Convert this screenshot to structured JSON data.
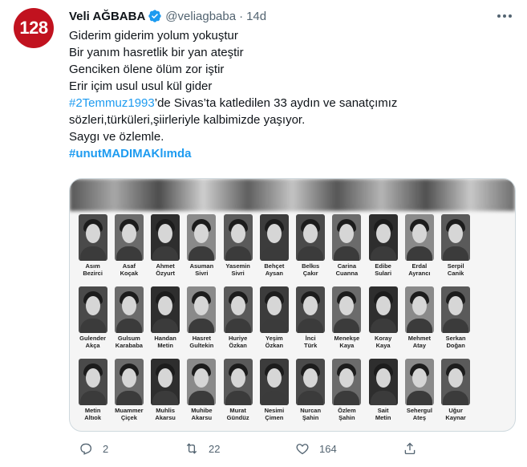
{
  "tweet": {
    "avatar_text": "128",
    "display_name": "Veli AĞBABA",
    "handle": "@veliagbaba",
    "separator": "·",
    "time": "14d",
    "body": {
      "l1": "Giderim giderim yolum yokuştur",
      "l2": "Bir yanım hasretlik bir yan ateştir",
      "l3": "Genciken ölene ölüm zor iştir",
      "l4": "Erir içim usul usul kül gider",
      "l5_hashtag": "#2Temmuz1993",
      "l5_rest": "’de Sivas’ta katledilen 33 aydın ve sanatçımız",
      "l6": "sözleri,türküleri,şiirleriyle kalbimizde yaşıyor.",
      "l7": "Saygı ve özlemle.",
      "l8_hashtag": "#unutMADIMAKlımda"
    }
  },
  "media": {
    "people": [
      {
        "n1": "Asım",
        "n2": "Bezirci"
      },
      {
        "n1": "Asaf",
        "n2": "Koçak"
      },
      {
        "n1": "Ahmet",
        "n2": "Özyurt"
      },
      {
        "n1": "Asuman",
        "n2": "Sivri"
      },
      {
        "n1": "Yasemin",
        "n2": "Sivri"
      },
      {
        "n1": "Behçet",
        "n2": "Aysan"
      },
      {
        "n1": "Belkıs",
        "n2": "Çakır"
      },
      {
        "n1": "Carina",
        "n2": "Cuanna"
      },
      {
        "n1": "Edibe",
        "n2": "Sulari"
      },
      {
        "n1": "Erdal",
        "n2": "Ayrancı"
      },
      {
        "n1": "Serpil",
        "n2": "Canik"
      },
      {
        "n1": "",
        "n2": ""
      },
      {
        "n1": "Gulender",
        "n2": "Akça"
      },
      {
        "n1": "Gulsum",
        "n2": "Karababa"
      },
      {
        "n1": "Handan",
        "n2": "Metin"
      },
      {
        "n1": "Hasret",
        "n2": "Gultekin"
      },
      {
        "n1": "Huriye",
        "n2": "Özkan"
      },
      {
        "n1": "Yeşim",
        "n2": "Özkan"
      },
      {
        "n1": "İnci",
        "n2": "Türk"
      },
      {
        "n1": "Menekşe",
        "n2": "Kaya"
      },
      {
        "n1": "Koray",
        "n2": "Kaya"
      },
      {
        "n1": "Mehmet",
        "n2": "Atay"
      },
      {
        "n1": "Serkan",
        "n2": "Doğan"
      },
      {
        "n1": "",
        "n2": ""
      },
      {
        "n1": "Metin",
        "n2": "Altıok"
      },
      {
        "n1": "Muammer",
        "n2": "Çiçek"
      },
      {
        "n1": "Muhlis",
        "n2": "Akarsu"
      },
      {
        "n1": "Muhibe",
        "n2": "Akarsu"
      },
      {
        "n1": "Murat",
        "n2": "Gündüz"
      },
      {
        "n1": "Nesimi",
        "n2": "Çimen"
      },
      {
        "n1": "Nurcan",
        "n2": "Şahin"
      },
      {
        "n1": "Özlem",
        "n2": "Şahin"
      },
      {
        "n1": "Sait",
        "n2": "Metin"
      },
      {
        "n1": "Sehergul",
        "n2": "Ateş"
      },
      {
        "n1": "Uğur",
        "n2": "Kaynar"
      },
      {
        "n1": "",
        "n2": ""
      }
    ]
  },
  "actions": {
    "reply_count": "2",
    "retweet_count": "22",
    "like_count": "164"
  },
  "colors": {
    "accent": "#1d9bf0",
    "avatar_bg": "#c1121f",
    "muted": "#536471"
  }
}
